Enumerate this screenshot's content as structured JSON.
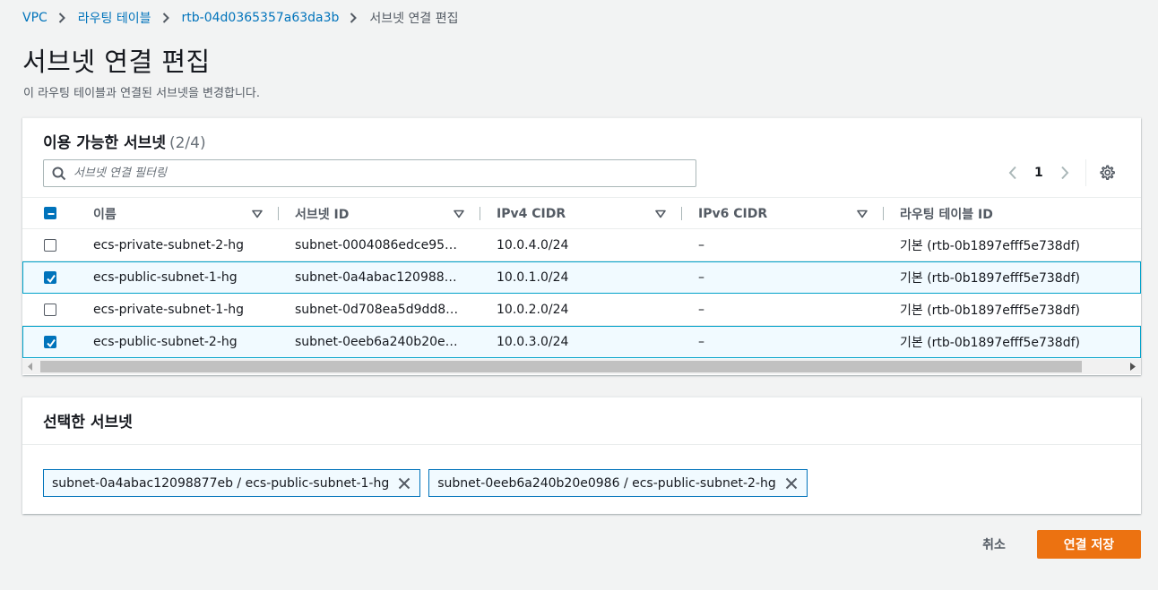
{
  "breadcrumb": {
    "items": [
      "VPC",
      "라우팅 테이블",
      "rtb-04d0365357a63da3b"
    ],
    "current": "서브넷 연결 편집"
  },
  "page": {
    "title": "서브넷 연결 편집",
    "description": "이 라우팅 테이블과 연결된 서브넷을 변경합니다."
  },
  "available": {
    "title": "이용 가능한 서브넷",
    "count": "(2/4)",
    "filter_placeholder": "서브넷 연결 필터링",
    "page_number": "1",
    "columns": [
      "이름",
      "서브넷 ID",
      "IPv4 CIDR",
      "IPv6 CIDR",
      "라우팅 테이블 ID"
    ],
    "rows": [
      {
        "selected": false,
        "name": "ecs-private-subnet-2-hg",
        "subnet_id": "subnet-0004086edce95…",
        "ipv4": "10.0.4.0/24",
        "ipv6": "–",
        "route_table": "기본 (rtb-0b1897efff5e738df)"
      },
      {
        "selected": true,
        "name": "ecs-public-subnet-1-hg",
        "subnet_id": "subnet-0a4abac120988…",
        "ipv4": "10.0.1.0/24",
        "ipv6": "–",
        "route_table": "기본 (rtb-0b1897efff5e738df)"
      },
      {
        "selected": false,
        "name": "ecs-private-subnet-1-hg",
        "subnet_id": "subnet-0d708ea5d9dd8…",
        "ipv4": "10.0.2.0/24",
        "ipv6": "–",
        "route_table": "기본 (rtb-0b1897efff5e738df)"
      },
      {
        "selected": true,
        "name": "ecs-public-subnet-2-hg",
        "subnet_id": "subnet-0eeb6a240b20e…",
        "ipv4": "10.0.3.0/24",
        "ipv6": "–",
        "route_table": "기본 (rtb-0b1897efff5e738df)"
      }
    ]
  },
  "selected": {
    "title": "선택한 서브넷",
    "tokens": [
      "subnet-0a4abac12098877eb / ecs-public-subnet-1-hg",
      "subnet-0eeb6a240b20e0986 / ecs-public-subnet-2-hg"
    ]
  },
  "footer": {
    "cancel_label": "취소",
    "save_label": "연결 저장"
  },
  "colors": {
    "link": "#0073bb",
    "primary_button": "#ec7211",
    "selected_row_bg": "#f1faff",
    "selected_row_border": "#00a1c9"
  }
}
